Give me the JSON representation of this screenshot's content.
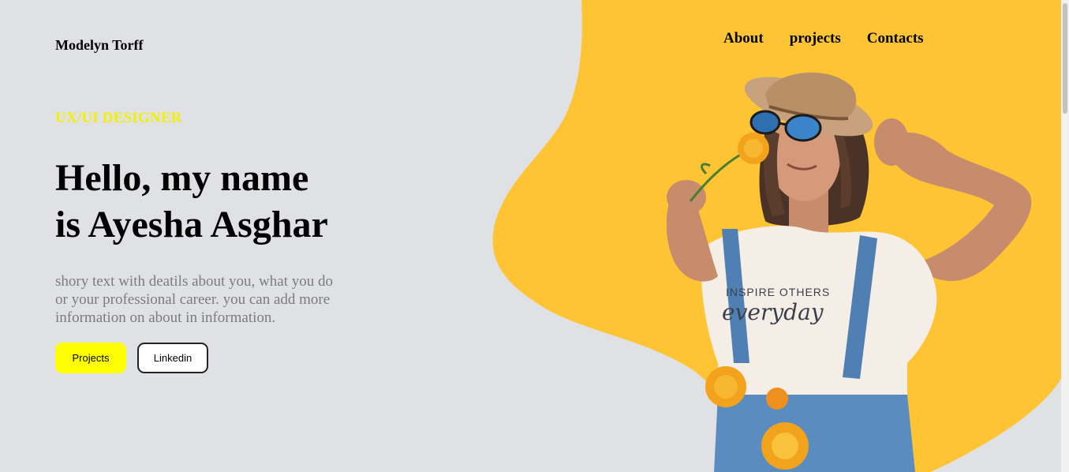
{
  "header": {
    "brand": "Modelyn Torff",
    "nav": [
      {
        "label": "About"
      },
      {
        "label": "projects"
      },
      {
        "label": "Contacts"
      }
    ]
  },
  "hero": {
    "subtitle": "UX/UI DESIGNER",
    "headline_line1": "Hello, my name",
    "headline_line2": "is Ayesha Asghar",
    "description": "shory text with deatils about you, what you do or your professional career. you can add more information on about in information.",
    "buttons": {
      "primary_label": "Projects",
      "secondary_label": "Linkedin"
    }
  },
  "colors": {
    "background": "#e0e1e5",
    "accent_yellow": "#fec434",
    "subtitle_yellow": "#f0f000",
    "button_yellow": "#ffff00"
  }
}
